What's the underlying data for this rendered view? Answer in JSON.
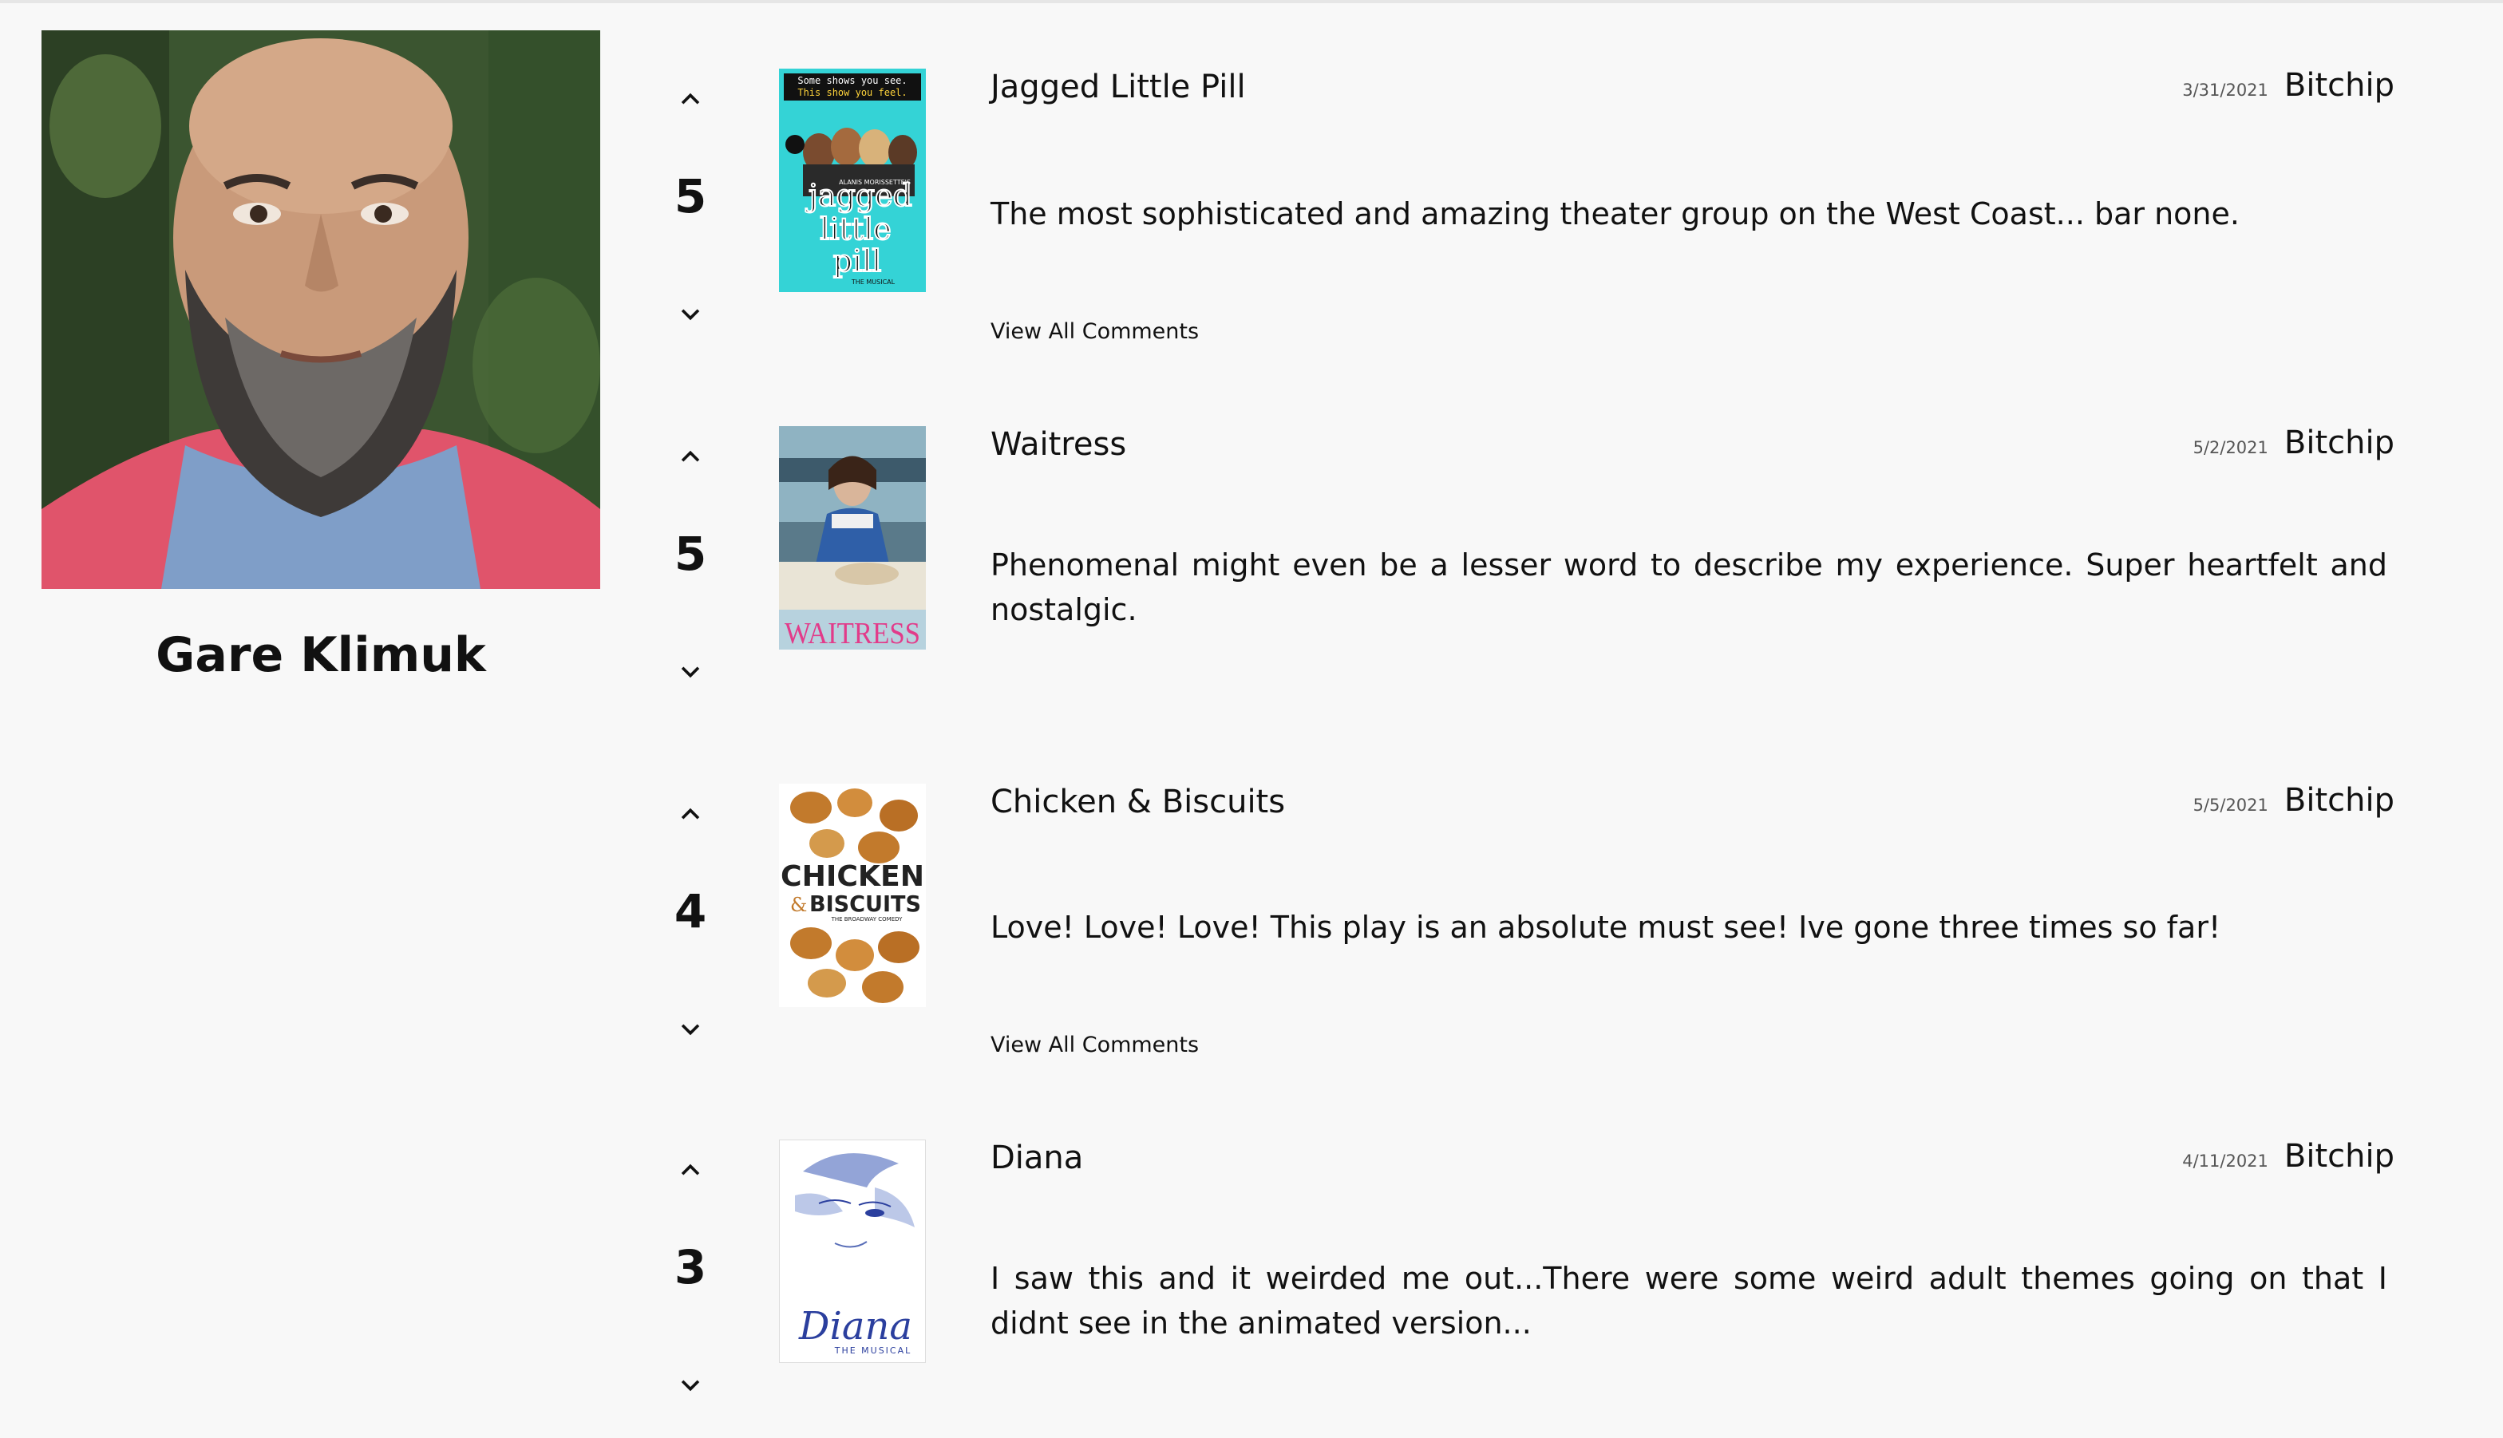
{
  "profile": {
    "name": "Gare Klimuk"
  },
  "reviews": [
    {
      "title": "Jagged Little Pill",
      "date": "3/31/2021",
      "user": "Bitchip",
      "score": "5",
      "body": "The most sophisticated and amazing theater group on the West Coast... bar none.",
      "comments_link": "View All Comments",
      "poster": {
        "tagline_1": "Some shows you see.",
        "tagline_2": "This show you feel.",
        "credit": "ALANIS MORISSETTE'S",
        "line_1": "jagged",
        "line_2": "little",
        "line_3": "pill",
        "subtitle": "THE MUSICAL",
        "accent": "#34d3d6"
      }
    },
    {
      "title": "Waitress",
      "date": "5/2/2021",
      "user": "Bitchip",
      "score": "5",
      "body": "Phenomenal might even be a lesser word to describe my experience. Super heartfelt and nostalgic.",
      "comments_link": "",
      "poster": {
        "word": "WAITRESS",
        "accent": "#e23b8a"
      }
    },
    {
      "title": "Chicken & Biscuits",
      "date": "5/5/2021",
      "user": "Bitchip",
      "score": "4",
      "body": "Love! Love! Love! This play is an absolute must see! Ive gone three times so far!",
      "comments_link": "View All Comments",
      "poster": {
        "line_1": "CHICKEN",
        "amp": "&",
        "line_2": "BISCUITS",
        "subtitle": "THE BROADWAY COMEDY",
        "accent": "#c27a2c"
      }
    },
    {
      "title": "Diana",
      "date": "4/11/2021",
      "user": "Bitchip",
      "score": "3",
      "body": "I saw this and it weirded me out...There were some weird adult themes going on that I didnt see in the animated version...",
      "comments_link": "",
      "poster": {
        "word": "Diana",
        "subtitle": "THE MUSICAL",
        "accent": "#2b3f9e"
      }
    }
  ]
}
